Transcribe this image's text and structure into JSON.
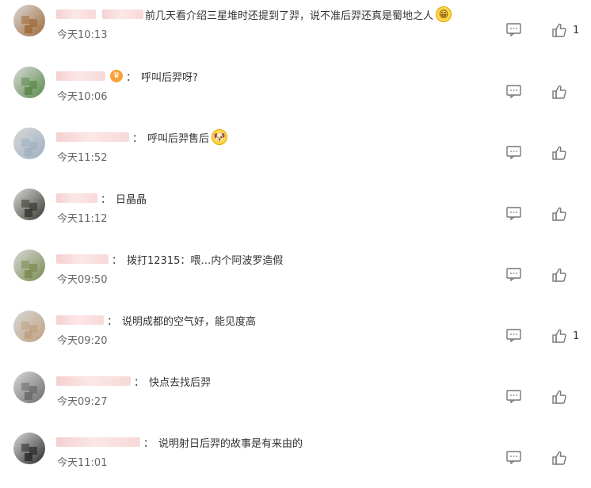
{
  "comments": [
    {
      "text": "前几天看介绍三星堆时还提到了羿，说不准后羿还真是蜀地之人",
      "time": "今天10:13",
      "likes": "1",
      "emoji": "grin-emoji-icon",
      "badge": "",
      "avatar": "#a06a3a"
    },
    {
      "text": "呼叫后羿呀?",
      "time": "今天10:06",
      "likes": "",
      "emoji": "",
      "badge": "crown-badge-icon",
      "avatar": "#5a8a4a"
    },
    {
      "text": "呼叫后羿售后",
      "time": "今天11:52",
      "likes": "",
      "emoji": "doge-emoji-icon",
      "badge": "",
      "avatar": "#9fb0c0"
    },
    {
      "text": "日晶晶",
      "time": "今天11:12",
      "likes": "",
      "emoji": "",
      "badge": "",
      "avatar": "#3a3a32"
    },
    {
      "text": "拨打12315：喂…内个阿波罗造假",
      "time": "今天09:50",
      "likes": "",
      "emoji": "",
      "badge": "",
      "avatar": "#7a8a50"
    },
    {
      "text": "说明成都的空气好，能见度高",
      "time": "今天09:20",
      "likes": "1",
      "emoji": "",
      "badge": "",
      "avatar": "#c0a080"
    },
    {
      "text": "快点去找后羿",
      "time": "今天09:27",
      "likes": "",
      "emoji": "",
      "badge": "",
      "avatar": "#6a6a6a"
    },
    {
      "text": "说明射日后羿的故事是有来由的",
      "time": "今天11:01",
      "likes": "",
      "emoji": "",
      "badge": "",
      "avatar": "#2a2a2a"
    }
  ]
}
